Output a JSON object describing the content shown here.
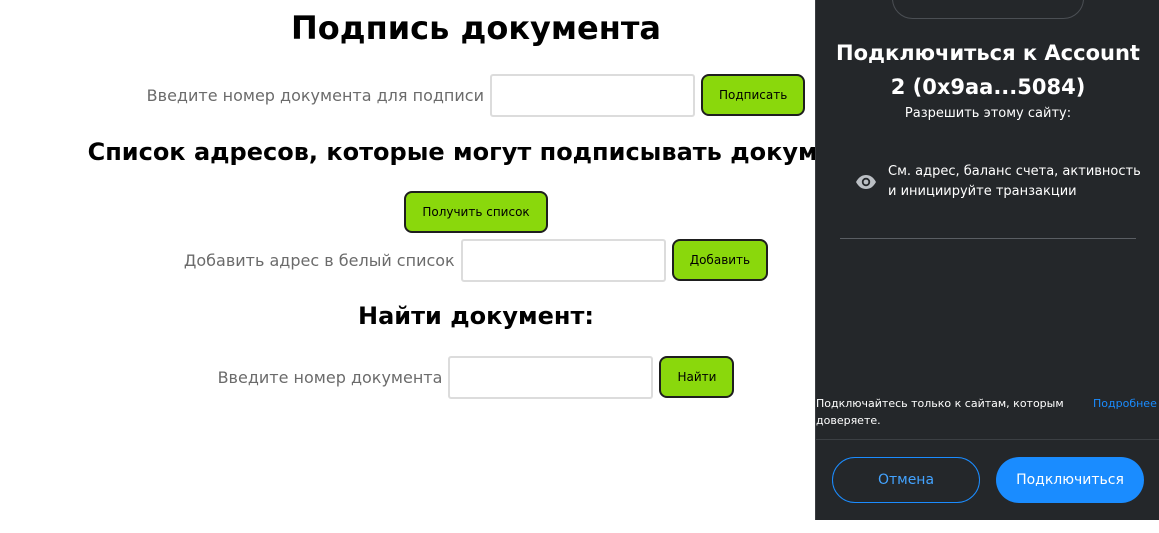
{
  "page": {
    "title": "Подпись документа",
    "sign": {
      "label": "Введите номер документа для подписи",
      "value": "",
      "button": "Подписать"
    },
    "whitelist_title": "Список адресов, которые могут подписывать документ",
    "get_list_button": "Получить список",
    "add": {
      "label": "Добавить адрес в белый список",
      "value": "",
      "button": "Добавить"
    },
    "find_title": "Найти документ:",
    "find": {
      "label": "Введите номер документа",
      "value": "",
      "button": "Найти"
    }
  },
  "wallet": {
    "title_line1": "Подключиться к Account",
    "title_line2": "2 (0x9aa...5084)",
    "subtitle": "Разрешить этому сайту:",
    "permission": "См. адрес, баланс счета, активность и инициируйте транзакции",
    "permission_icon": "eye-icon",
    "note": "Подключайтесь только к сайтам, которым доверяете.",
    "learn_more": "Подробнее",
    "cancel": "Отмена",
    "connect": "Подключиться",
    "colors": {
      "bg": "#24272a",
      "primary": "#1a8cff",
      "accent_button": "#8ad80c"
    }
  }
}
